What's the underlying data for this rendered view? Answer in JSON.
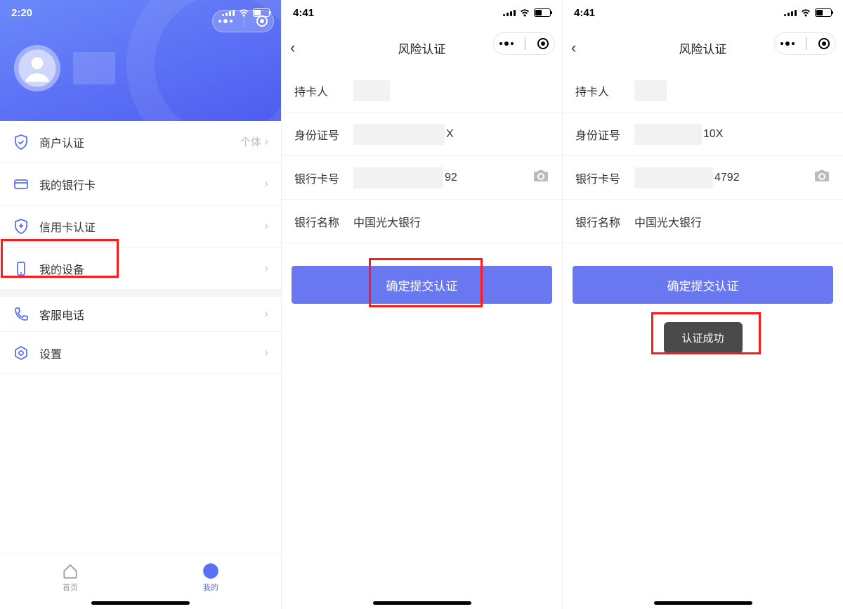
{
  "screen1": {
    "time": "2:20",
    "menu": [
      {
        "label": "商户认证",
        "extra": "个体"
      },
      {
        "label": "我的银行卡",
        "extra": ""
      },
      {
        "label": "信用卡认证",
        "extra": ""
      },
      {
        "label": "我的设备",
        "extra": ""
      },
      {
        "label": "客服电话",
        "extra": ""
      },
      {
        "label": "设置",
        "extra": ""
      }
    ],
    "tabs": {
      "home": "首页",
      "mine": "我的"
    }
  },
  "screen2": {
    "time": "4:41",
    "title": "风险认证",
    "rows": {
      "holder_label": "持卡人",
      "id_label": "身份证号",
      "id_tail": "X",
      "card_label": "银行卡号",
      "card_tail": "92",
      "bank_label": "银行名称",
      "bank_value": "中国光大银行"
    },
    "submit": "确定提交认证"
  },
  "screen3": {
    "time": "4:41",
    "title": "风险认证",
    "rows": {
      "holder_label": "持卡人",
      "id_label": "身份证号",
      "id_tail": "10X",
      "card_label": "银行卡号",
      "card_tail": "4792",
      "bank_label": "银行名称",
      "bank_value": "中国光大银行"
    },
    "submit": "确定提交认证",
    "toast": "认证成功"
  }
}
